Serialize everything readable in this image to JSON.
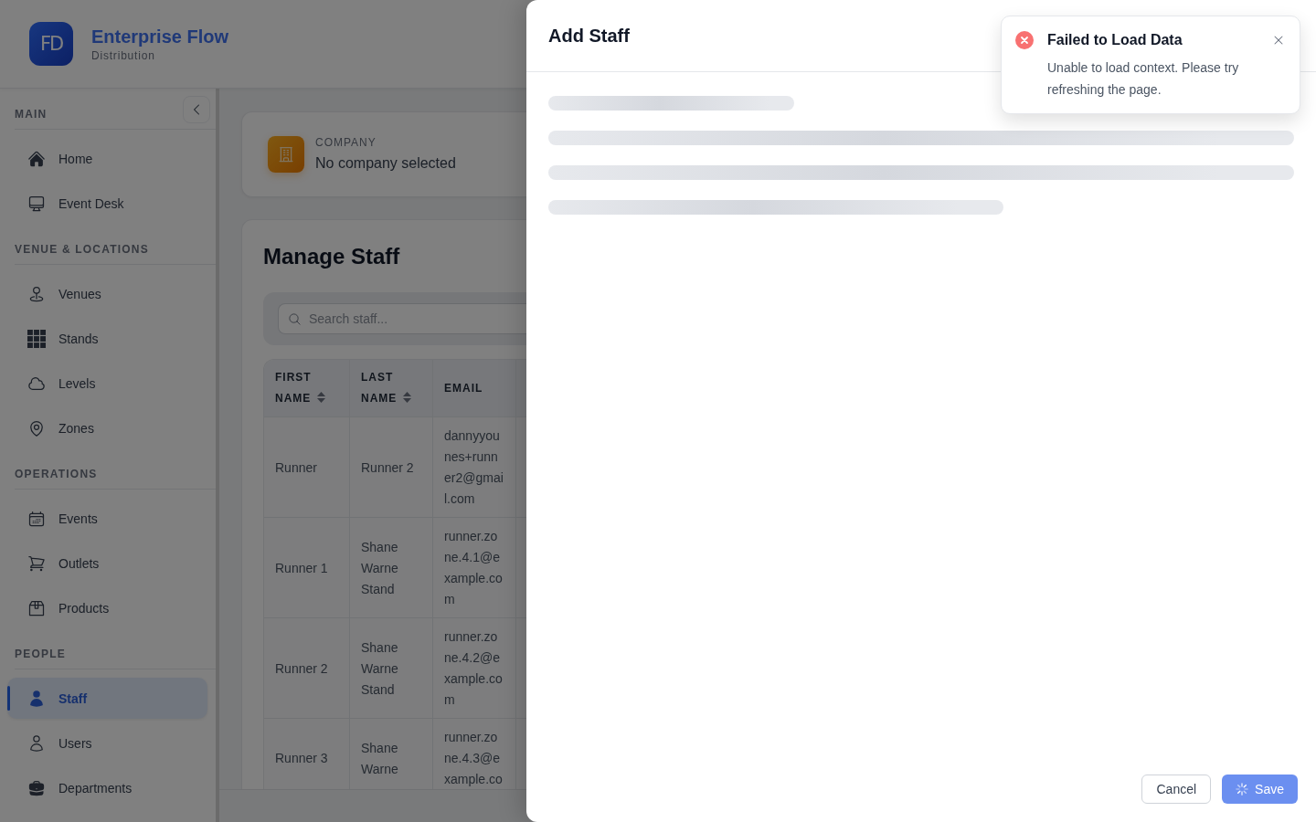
{
  "header": {
    "logo_text": "FD",
    "app_name": "Enterprise Flow",
    "subtitle": "Distribution"
  },
  "sidebar": {
    "sections": [
      {
        "title": "MAIN",
        "items": [
          {
            "label": "Home",
            "selected": false
          },
          {
            "label": "Event Desk",
            "selected": false
          }
        ]
      },
      {
        "title": "VENUE & LOCATIONS",
        "items": [
          {
            "label": "Venues",
            "selected": false
          },
          {
            "label": "Stands",
            "selected": false
          },
          {
            "label": "Levels",
            "selected": false
          },
          {
            "label": "Zones",
            "selected": false
          }
        ]
      },
      {
        "title": "OPERATIONS",
        "items": [
          {
            "label": "Events",
            "selected": false
          },
          {
            "label": "Outlets",
            "selected": false
          },
          {
            "label": "Products",
            "selected": false
          }
        ]
      },
      {
        "title": "PEOPLE",
        "items": [
          {
            "label": "Staff",
            "selected": true
          },
          {
            "label": "Users",
            "selected": false
          },
          {
            "label": "Departments",
            "selected": false
          }
        ]
      }
    ]
  },
  "company": {
    "label": "COMPANY",
    "value": "No company selected"
  },
  "staff": {
    "title": "Manage Staff",
    "search": {
      "placeholder": "Search staff..."
    },
    "table": {
      "columns": [
        {
          "label": "FIRST NAME",
          "sortable": true
        },
        {
          "label": "LAST NAME",
          "sortable": true
        },
        {
          "label": "EMAIL",
          "sortable": false
        }
      ],
      "rows": [
        [
          "Runner",
          "Runner 2",
          "dannyyounes+runner2@gmail.com"
        ],
        [
          "Runner 1",
          "Shane Warne Stand",
          "runner.zone.4.1@example.com"
        ],
        [
          "Runner 2",
          "Shane Warne Stand",
          "runner.zone.4.2@example.com"
        ],
        [
          "Runner 3",
          "Shane Warne",
          "runner.zone.4.3@example.co"
        ]
      ]
    }
  },
  "drawer": {
    "title": "Add Staff",
    "loading": true,
    "buttons": [
      {
        "label": "Cancel",
        "kind": "secondary",
        "loading": false
      },
      {
        "label": "Save",
        "kind": "primary",
        "loading": true
      }
    ]
  },
  "toast": {
    "kind": "error",
    "title": "Failed to Load Data",
    "message": "Unable to load context. Please try refreshing the page."
  }
}
